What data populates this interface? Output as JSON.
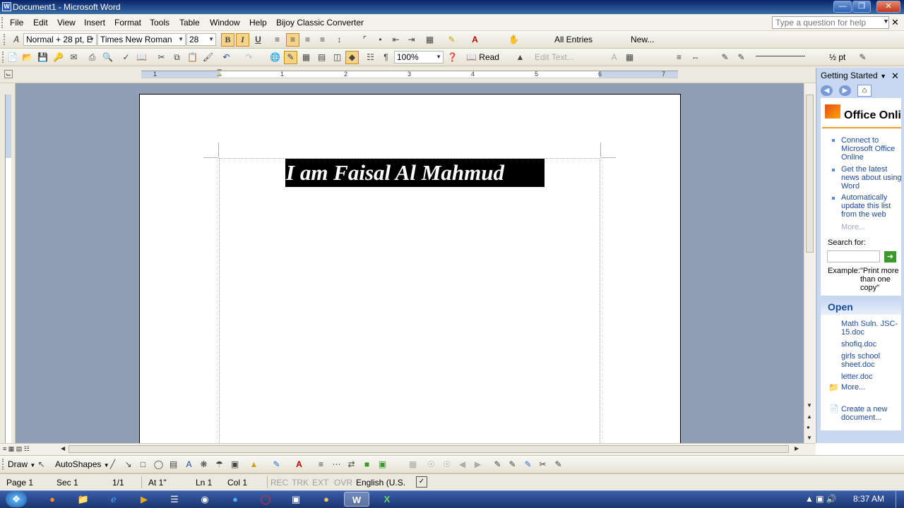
{
  "window": {
    "title": "Document1 - Microsoft Word"
  },
  "menubar": {
    "items": [
      "File",
      "Edit",
      "View",
      "Insert",
      "Format",
      "Tools",
      "Table",
      "Window",
      "Help",
      "Bijoy Classic Converter"
    ],
    "help_placeholder": "Type a question for help"
  },
  "formatting": {
    "style": "Normal + 28 pt, E",
    "font": "Times New Roman",
    "size": "28",
    "bold": "B",
    "italic": "I",
    "underline": "U",
    "all_entries": "All Entries",
    "new": "New..."
  },
  "standard": {
    "zoom": "100%",
    "read": "Read",
    "edit_text": "Edit Text...",
    "line_weight": "½ pt"
  },
  "ruler": {
    "numbers": [
      "1",
      "1",
      "2",
      "3",
      "4",
      "5",
      "6",
      "7"
    ]
  },
  "document": {
    "heading": "I am Faisal Al Mahmud"
  },
  "taskpane": {
    "title": "Getting Started",
    "logo": "Office Online",
    "links": [
      "Connect to Microsoft Office Online",
      "Get the latest news about using Word",
      "Automatically update this list from the web"
    ],
    "more1": "More...",
    "search_label": "Search for:",
    "example_label": "Example:",
    "example_text": "\"Print more than one copy\"",
    "open_header": "Open",
    "files": [
      "Math Suln. JSC-15.doc",
      "shofiq.doc",
      "girls school sheet.doc",
      "letter.doc"
    ],
    "more2": "More...",
    "create": "Create a new document..."
  },
  "drawbar": {
    "draw": "Draw",
    "autoshapes": "AutoShapes"
  },
  "status": {
    "page": "Page 1",
    "sec": "Sec 1",
    "pages": "1/1",
    "at": "At 1\"",
    "ln": "Ln 1",
    "col": "Col 1",
    "rec": "REC",
    "trk": "TRK",
    "ext": "EXT",
    "ovr": "OVR",
    "lang": "English (U.S."
  },
  "taskbar": {
    "clock": "8:37 AM"
  },
  "colors": {
    "selection": "#000000",
    "title_bar": "#0a246a",
    "link": "#1c4aa0"
  }
}
